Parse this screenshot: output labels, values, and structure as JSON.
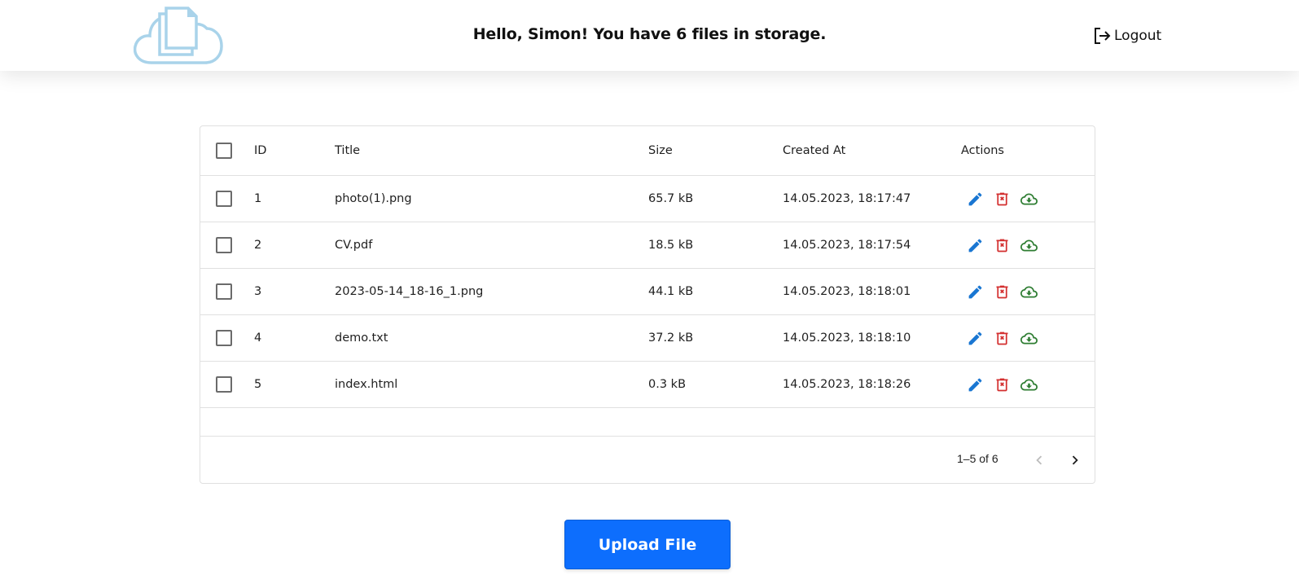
{
  "header": {
    "greeting": "Hello, Simon! You have 6 files in storage.",
    "logout_label": "Logout",
    "logo_icon": "cloud-files-logo",
    "logo_color": "#a9d3ea"
  },
  "table": {
    "columns": {
      "id": "ID",
      "title": "Title",
      "size": "Size",
      "created_at": "Created At",
      "actions": "Actions"
    },
    "rows": [
      {
        "id": "1",
        "title": "photo(1).png",
        "size": "65.7 kB",
        "created_at": "14.05.2023, 18:17:47"
      },
      {
        "id": "2",
        "title": "CV.pdf",
        "size": "18.5 kB",
        "created_at": "14.05.2023, 18:17:54"
      },
      {
        "id": "3",
        "title": "2023-05-14_18-16_1.png",
        "size": "44.1 kB",
        "created_at": "14.05.2023, 18:18:01"
      },
      {
        "id": "4",
        "title": "demo.txt",
        "size": "37.2 kB",
        "created_at": "14.05.2023, 18:18:10"
      },
      {
        "id": "5",
        "title": "index.html",
        "size": "0.3 kB",
        "created_at": "14.05.2023, 18:18:26"
      }
    ],
    "action_icons": [
      "edit-icon",
      "delete-icon",
      "download-icon"
    ],
    "action_colors": {
      "edit": "#1976d2",
      "delete": "#d32f2f",
      "download": "#2e7d32"
    }
  },
  "pagination": {
    "range_text": "1–5 of 6",
    "prev_icon": "chevron-left-icon",
    "next_icon": "chevron-right-icon"
  },
  "upload": {
    "label": "Upload File",
    "color": "#0d6efd"
  }
}
